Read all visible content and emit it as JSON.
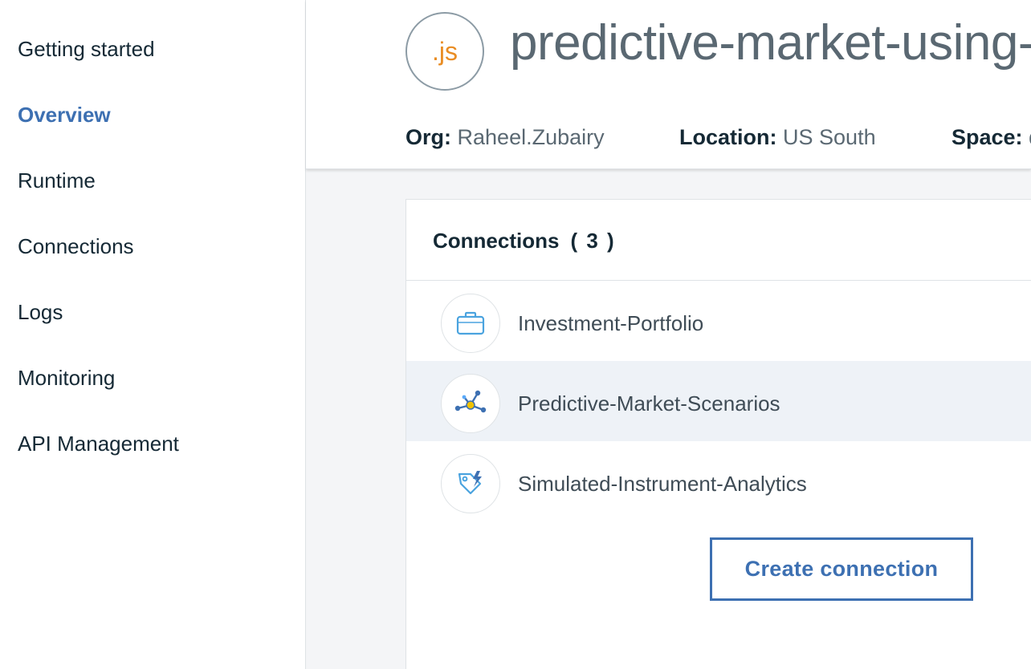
{
  "sidebar": {
    "items": [
      {
        "label": "Getting started",
        "active": false
      },
      {
        "label": "Overview",
        "active": true
      },
      {
        "label": "Runtime",
        "active": false
      },
      {
        "label": "Connections",
        "active": false
      },
      {
        "label": "Logs",
        "active": false
      },
      {
        "label": "Monitoring",
        "active": false
      },
      {
        "label": "API Management",
        "active": false
      }
    ]
  },
  "header": {
    "app_icon_text": ".js",
    "app_title": "predictive-market-using-a",
    "org_label": "Org:",
    "org_value": "Raheel.Zubairy",
    "location_label": "Location:",
    "location_value": "US South",
    "space_label": "Space:",
    "space_value": "d"
  },
  "connections": {
    "title": "Connections",
    "count": "( 3 )",
    "items": [
      {
        "label": "Investment-Portfolio",
        "icon": "briefcase-icon"
      },
      {
        "label": "Predictive-Market-Scenarios",
        "icon": "network-icon",
        "highlighted": true
      },
      {
        "label": "Simulated-Instrument-Analytics",
        "icon": "tag-lightning-icon"
      }
    ],
    "create_button_label": "Create connection"
  },
  "colors": {
    "accent": "#3d70b2",
    "js_orange": "#e98d24",
    "row_highlight": "#eef2f7"
  }
}
